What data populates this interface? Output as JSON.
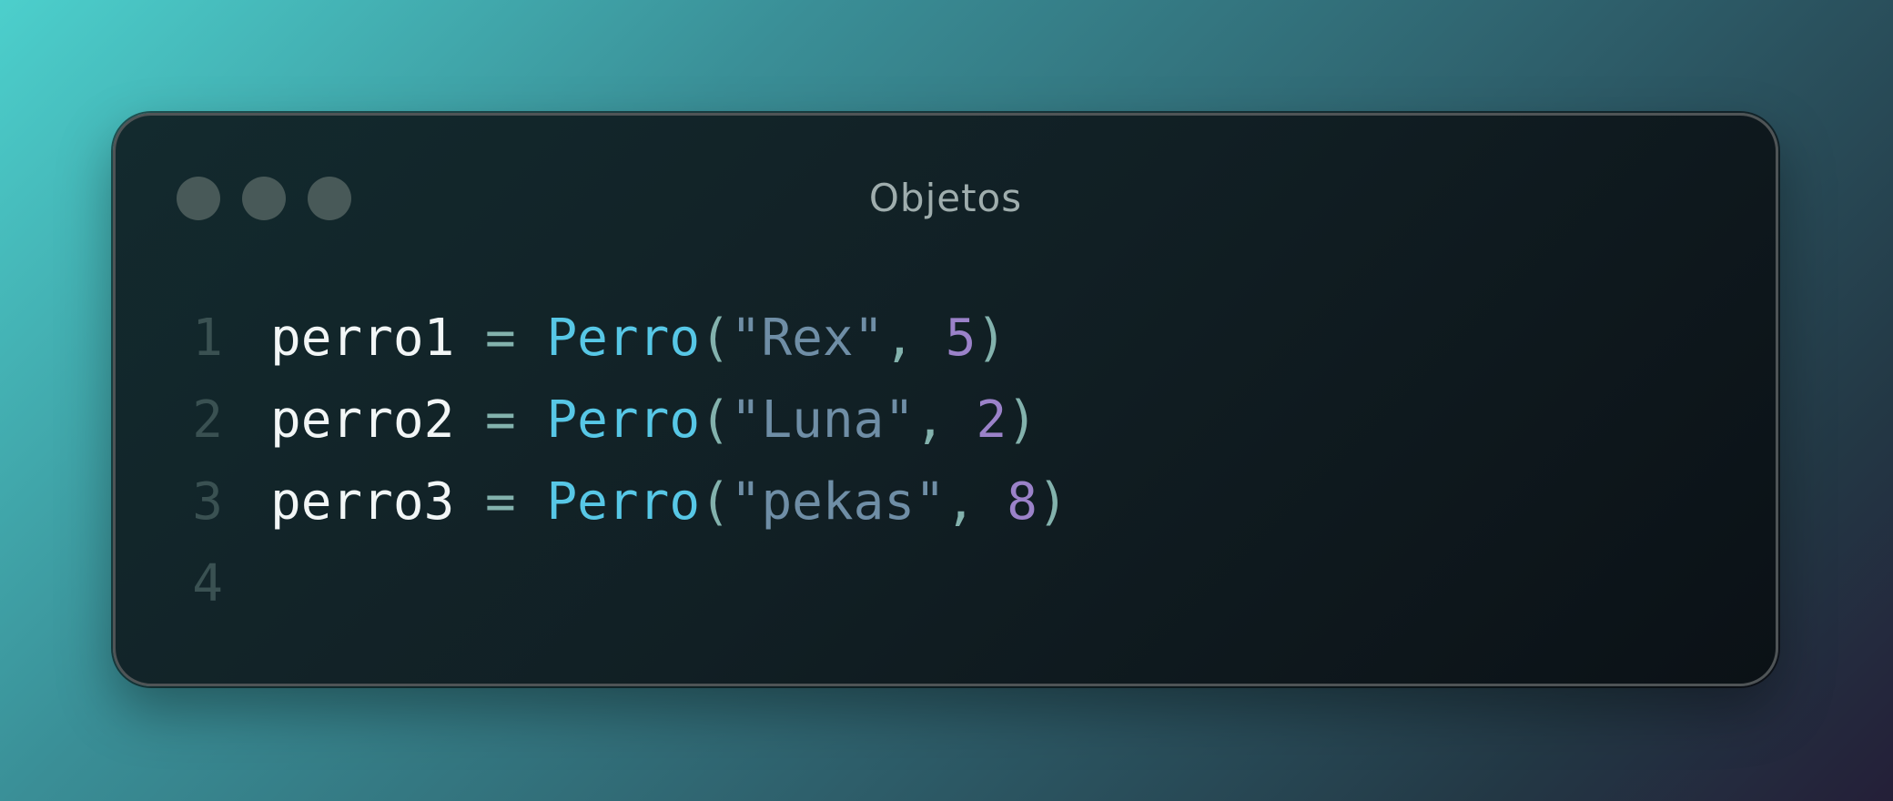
{
  "window": {
    "title": "Objetos",
    "controls": [
      "window-dot",
      "window-dot",
      "window-dot"
    ]
  },
  "code": {
    "lines": [
      {
        "number": "1",
        "var": "perro1",
        "op": " = ",
        "cls": "Perro",
        "open": "(",
        "str": "\"Rex\"",
        "comma": ", ",
        "num": "5",
        "close": ")"
      },
      {
        "number": "2",
        "var": "perro2",
        "op": " = ",
        "cls": "Perro",
        "open": "(",
        "str": "\"Luna\"",
        "comma": ", ",
        "num": "2",
        "close": ")"
      },
      {
        "number": "3",
        "var": "perro3",
        "op": " = ",
        "cls": "Perro",
        "open": "(",
        "str": "\"pekas\"",
        "comma": ", ",
        "num": "8",
        "close": ")"
      },
      {
        "number": "4",
        "var": "",
        "op": "",
        "cls": "",
        "open": "",
        "str": "",
        "comma": "",
        "num": "",
        "close": ""
      }
    ]
  },
  "colors": {
    "variable": "#f2f6f6",
    "operator": "#83b2ad",
    "class": "#57c7e6",
    "string": "#6f8ea6",
    "number": "#9b82c9",
    "line_number": "#3a5152"
  }
}
